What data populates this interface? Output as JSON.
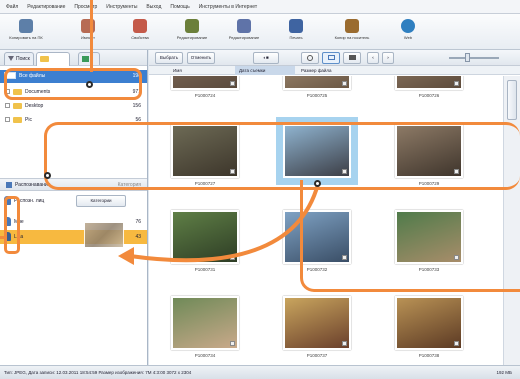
{
  "menubar": {
    "items": [
      "Файл",
      "Редактирование",
      "Просмотр",
      "Инструменты",
      "Выход",
      "Помощь",
      "Инструменты в Интернет"
    ]
  },
  "toolbar": {
    "buttons": [
      {
        "label": "Копировать на ПК",
        "color": "#5d7fa8"
      },
      {
        "label": "Импорт",
        "color": "#b76b54"
      },
      {
        "label": "Свойства",
        "color": "#c45a4a"
      },
      {
        "label": "Редактирование",
        "color": "#6b7f3a"
      },
      {
        "label": "Редактирование",
        "color": "#5f73a8"
      },
      {
        "label": "Печать",
        "color": "#3f64a1"
      },
      {
        "label": "Копир на носитель",
        "color": "#9a6b2f"
      },
      {
        "label": "Web",
        "color": "#2f7fc0"
      }
    ]
  },
  "left": {
    "tabs": [
      "Поиск",
      "Папки"
    ],
    "tree": [
      {
        "label": "Все файлы",
        "count": "196"
      },
      {
        "label": "Documents",
        "count": "971"
      },
      {
        "label": "Desktop",
        "count": "156"
      },
      {
        "label": "Pic",
        "count": "56"
      }
    ],
    "people_header": "Распознавание",
    "people_tab2": "Категория",
    "people_label": "Распозн. лиц",
    "add_button": "Категории",
    "people": [
      {
        "label": "Мне",
        "count": "76"
      },
      {
        "label": "Lisa",
        "count": "43"
      }
    ]
  },
  "main": {
    "buttons": [
      "Выбрать все",
      "Отменить",
      "◐■",
      "",
      "",
      "",
      "",
      "‹",
      "›"
    ],
    "columns": [
      "Имя",
      "Дата съемки",
      "Размер файла"
    ],
    "thumbnails": [
      {
        "caption": "P1000724",
        "colors": [
          "#8a7462",
          "#5a4a3c"
        ],
        "selected": false
      },
      {
        "caption": "P1000725",
        "colors": [
          "#b09a80",
          "#6b5744"
        ],
        "selected": false
      },
      {
        "caption": "P1000726",
        "colors": [
          "#9c8670",
          "#5d4b3b"
        ],
        "selected": false
      },
      {
        "caption": "P1000727",
        "colors": [
          "#6d6a55",
          "#3d362b"
        ],
        "selected": false
      },
      {
        "caption": "P1000728",
        "colors": [
          "#8fb3cf",
          "#3c3e46"
        ],
        "selected": true
      },
      {
        "caption": "P1000729",
        "colors": [
          "#8d7a66",
          "#3f352c"
        ],
        "selected": false
      },
      {
        "caption": "P1000731",
        "colors": [
          "#5f7f46",
          "#2e3d25"
        ],
        "selected": false
      },
      {
        "caption": "P1000732",
        "colors": [
          "#7fa2c4",
          "#3a4e66"
        ],
        "selected": false
      },
      {
        "caption": "P1000733",
        "colors": [
          "#4f7b4a",
          "#a88d6a"
        ],
        "selected": false
      },
      {
        "caption": "P1000734",
        "colors": [
          "#6f8a58",
          "#c9a98a"
        ],
        "selected": false
      },
      {
        "caption": "P1000737",
        "colors": [
          "#c9a55e",
          "#6a3f2b"
        ],
        "selected": false
      },
      {
        "caption": "P1000738",
        "colors": [
          "#b99255",
          "#5c3a24"
        ],
        "selected": false
      }
    ]
  },
  "status": {
    "left": "Тип: JPEG, Дата записи: 12.03.2011 18:54:59  Размер изображения: 7M 4:3:00 3072 x 2304",
    "right": "192 МБ"
  },
  "annotation_color": "#f28a3c"
}
